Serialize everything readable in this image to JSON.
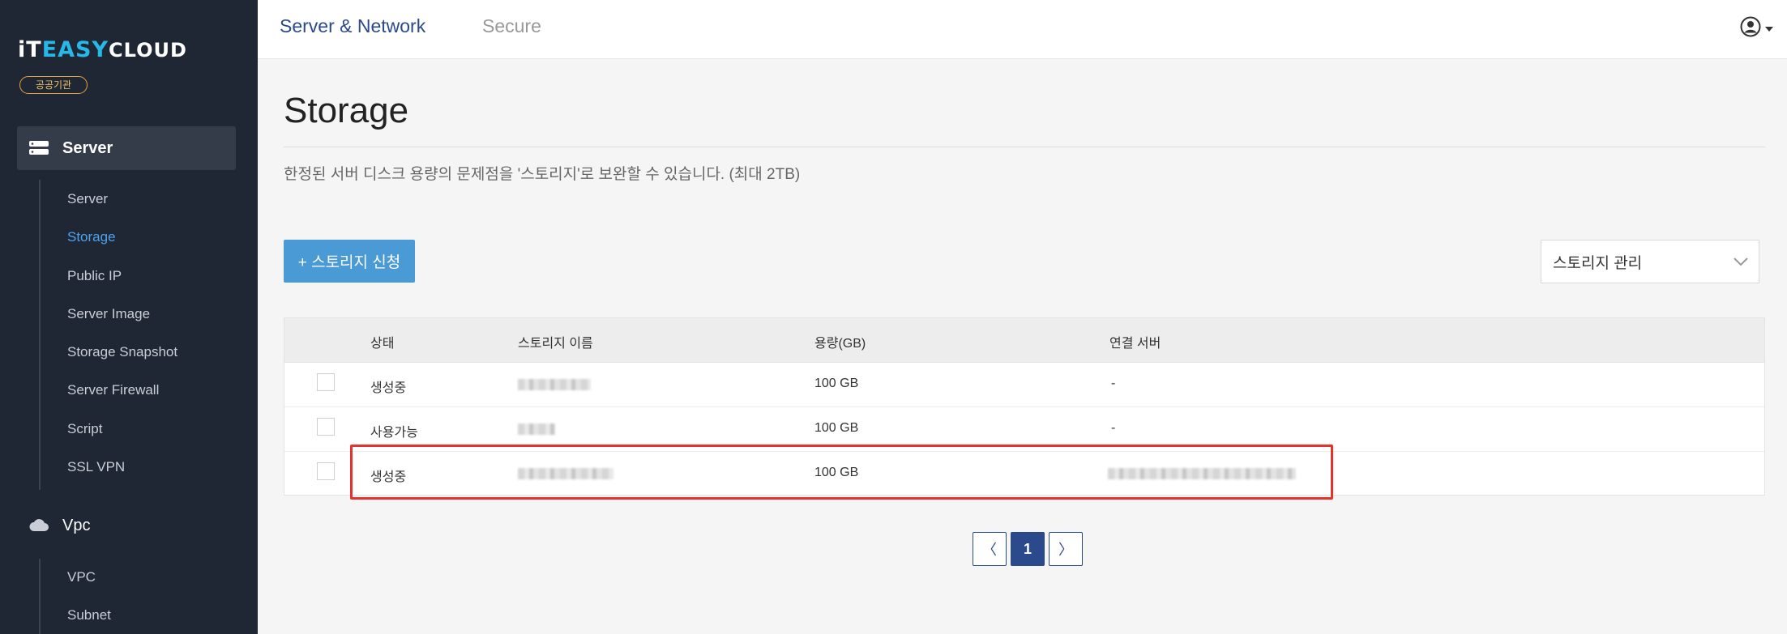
{
  "brand": {
    "logo_part1": "iT",
    "logo_part2": "EASY",
    "logo_part3": "CLOUD",
    "badge": "공공기관"
  },
  "sidebar": {
    "groups": [
      {
        "label": "Server",
        "icon": "server-icon",
        "active": true
      },
      {
        "label": "Vpc",
        "icon": "cloud-icon",
        "active": false
      }
    ],
    "server_items": [
      {
        "label": "Server"
      },
      {
        "label": "Storage",
        "active": true
      },
      {
        "label": "Public IP"
      },
      {
        "label": "Server Image"
      },
      {
        "label": "Storage Snapshot"
      },
      {
        "label": "Server Firewall"
      },
      {
        "label": "Script"
      },
      {
        "label": "SSL VPN"
      }
    ],
    "vpc_items": [
      {
        "label": "VPC"
      },
      {
        "label": "Subnet"
      }
    ]
  },
  "topbar": {
    "tabs": [
      {
        "label": "Server & Network",
        "active": true
      },
      {
        "label": "Secure",
        "active": false
      }
    ],
    "user_icon": "user-circle-icon"
  },
  "page": {
    "title": "Storage",
    "description": "한정된 서버 디스크 용량의 문제점을 '스토리지'로 보완할 수 있습니다. (최대 2TB)",
    "add_button": "+ 스토리지 신청",
    "manage_select": "스토리지 관리"
  },
  "table": {
    "headers": [
      "상태",
      "스토리지 이름",
      "용량(GB)",
      "연결 서버"
    ],
    "rows": [
      {
        "status": "생성중",
        "name": "",
        "capacity": "100 GB",
        "server": "-"
      },
      {
        "status": "사용가능",
        "name": "",
        "capacity": "100 GB",
        "server": "-"
      },
      {
        "status": "생성중",
        "name": "",
        "capacity": "100 GB",
        "server": ""
      }
    ]
  },
  "pagination": {
    "prev": "〈",
    "current": "1",
    "next": "〉"
  },
  "colors": {
    "sidebar_bg": "#1f2734",
    "accent_blue": "#2a4a8c",
    "button_blue": "#4a9ad6",
    "active_link": "#4da3ef",
    "highlight_red": "#e5322d"
  }
}
